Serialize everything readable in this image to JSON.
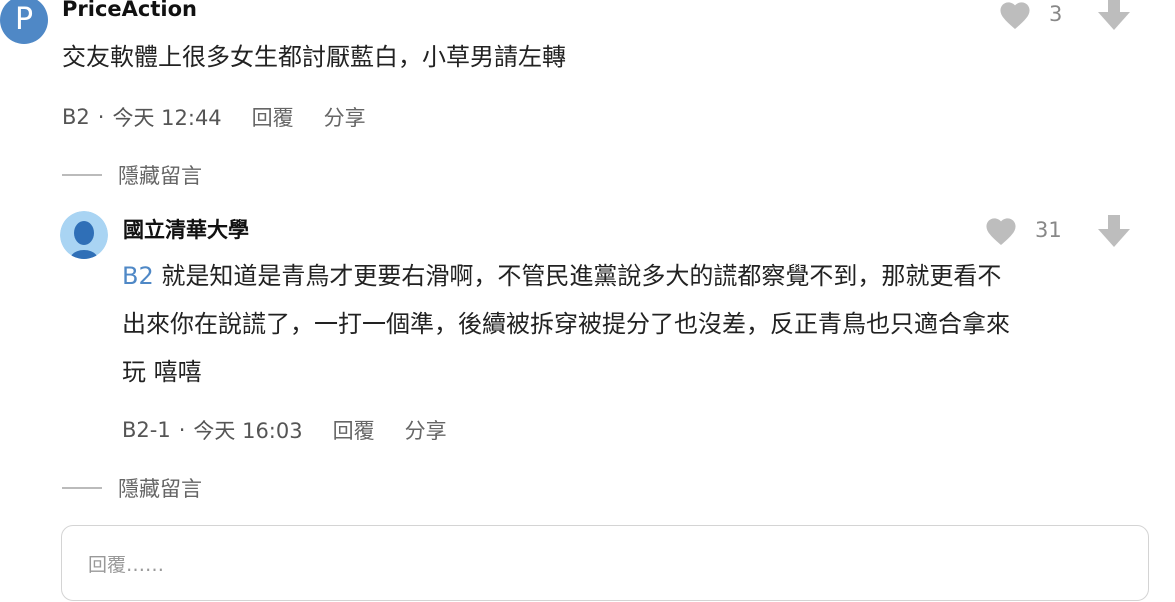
{
  "comments": [
    {
      "avatar_letter": "P",
      "author": "PriceAction",
      "text": "交友軟體上很多女生都討厭藍白，小草男請左轉",
      "floor": "B2",
      "time": "今天 12:44",
      "likes": "3",
      "reply_label": "回覆",
      "share_label": "分享",
      "hide_label": "隱藏留言"
    },
    {
      "author": "國立清華大學",
      "reply_to": "B2",
      "text_line1": "就是知道是青鳥才更要右滑啊，不管民進黨說多大的謊都察覺不到，那就更看不",
      "text_line2": "出來你在說謊了，一打一個準，後續被拆穿被提分了也沒差，反正青鳥也只適合拿來",
      "text_line3": "玩 嘻嘻",
      "floor": "B2-1",
      "time": "今天 16:03",
      "likes": "31",
      "reply_label": "回覆",
      "share_label": "分享",
      "hide_label": "隱藏留言"
    }
  ],
  "reply_box": {
    "placeholder": "回覆……"
  },
  "colors": {
    "accent": "#4f88c6",
    "icon_gray": "#bdbdbd",
    "muted_text": "#666666"
  },
  "icons": [
    "heart-icon",
    "down-arrow-icon",
    "person-avatar-icon"
  ]
}
